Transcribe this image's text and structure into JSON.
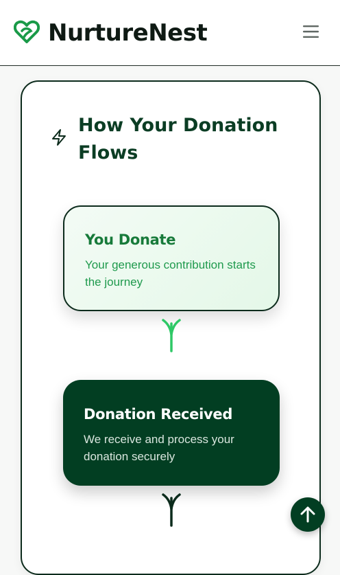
{
  "header": {
    "brand": "NurtureNest",
    "logo_icon": "heart-leaf-icon",
    "menu_icon": "hamburger-menu-icon"
  },
  "flow": {
    "title": "How Your Donation Flows",
    "title_icon": "lightning-bolt-icon",
    "steps": [
      {
        "title": "You Donate",
        "description": "Your generous contribution starts the journey"
      },
      {
        "title": "Donation Received",
        "description": "We receive and process your donation securely"
      }
    ],
    "connector_icon": "branch-arrow-icon"
  },
  "scroll_top": {
    "icon": "arrow-up-icon"
  },
  "colors": {
    "brand_dark_green": "#023e22",
    "heading_green": "#0b3d24",
    "accent_green": "#22c55e",
    "step1_title": "#177a3a",
    "step1_bg": "#e4f8e8"
  }
}
